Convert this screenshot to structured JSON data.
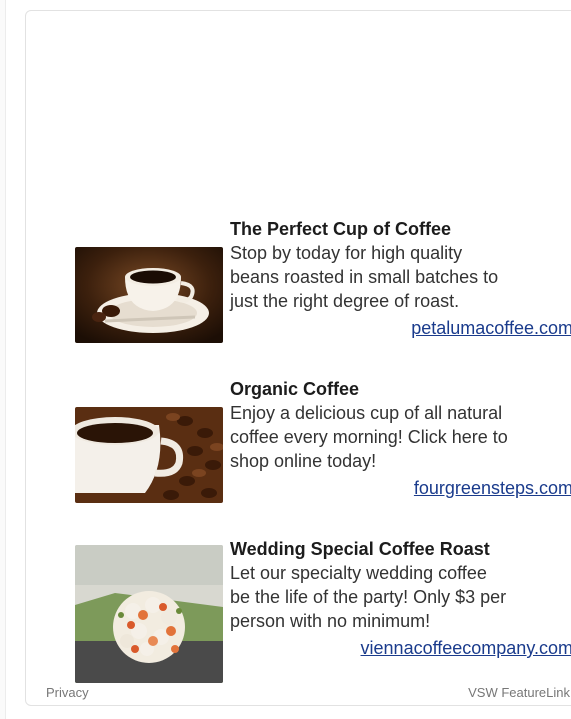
{
  "ads": [
    {
      "title": "The Perfect Cup of Coffee",
      "desc_lines": [
        "Stop by today for high quality",
        "beans roasted in small batches to",
        "just the right degree of roast."
      ],
      "link": "petalumacoffee.com",
      "image_icon": "coffee-cup-saucer-image"
    },
    {
      "title": "Organic Coffee",
      "desc_lines": [
        "Enjoy a delicious cup of all natural",
        "coffee every morning! Click here to",
        "shop online today!"
      ],
      "link": "fourgreensteps.com",
      "image_icon": "coffee-cup-beans-image"
    },
    {
      "title": "Wedding Special Coffee Roast",
      "desc_lines": [
        "Let our specialty wedding coffee",
        "be the life of the party! Only $3 per",
        "person with no minimum!"
      ],
      "link": "viennacoffeecompany.com",
      "image_icon": "wedding-bouquet-image"
    }
  ],
  "footer": {
    "privacy": "Privacy",
    "brand": "VSW FeatureLink"
  },
  "colors": {
    "title": "#1c1c1c",
    "text": "#333333",
    "link": "#1a3b8c",
    "footer": "#777777"
  }
}
